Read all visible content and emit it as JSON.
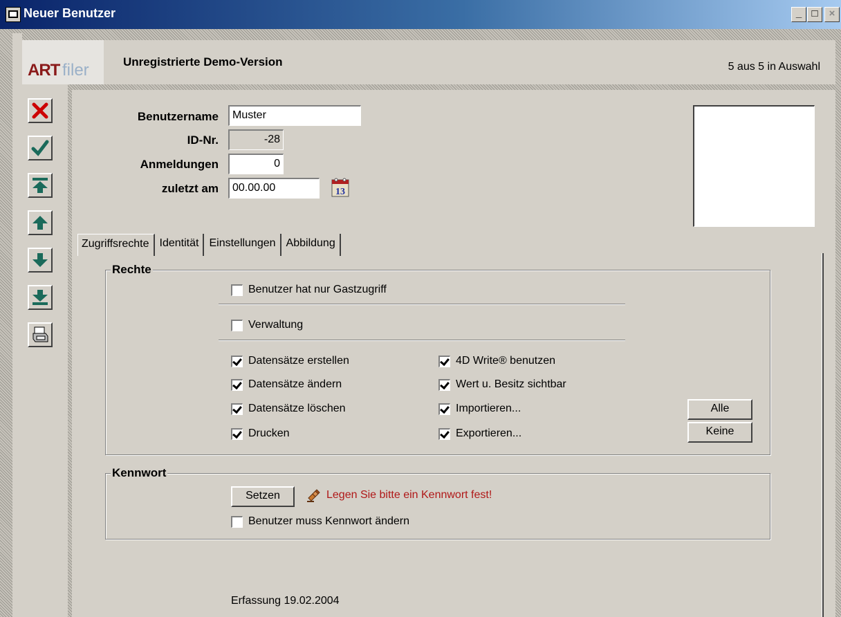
{
  "window": {
    "title": "Neuer Benutzer",
    "min_label": "_",
    "max_label": "□",
    "close_label": "×"
  },
  "header": {
    "logo_art": "ART",
    "logo_filer": "filer",
    "title": "Unregistrierte Demo-Version",
    "selection": "5 aus 5 in Auswahl"
  },
  "toolbar": {
    "items": [
      {
        "icon": "delete-x-icon"
      },
      {
        "icon": "check-icon"
      },
      {
        "icon": "first-record-icon"
      },
      {
        "icon": "previous-record-icon"
      },
      {
        "icon": "next-record-icon"
      },
      {
        "icon": "last-record-icon"
      },
      {
        "icon": "print-icon"
      }
    ]
  },
  "form": {
    "username_label": "Benutzername",
    "username_value": "Muster",
    "id_label": "ID-Nr.",
    "id_value": "-28",
    "logins_label": "Anmeldungen",
    "logins_value": "0",
    "last_label": "zuletzt am",
    "last_value": "00.00.00",
    "calendar_day": "13"
  },
  "tabs": [
    "Zugriffsrechte",
    "Identität",
    "Einstellungen",
    "Abbildung"
  ],
  "rights": {
    "title": "Rechte",
    "guest_only": {
      "label": "Benutzer hat nur Gastzugriff",
      "checked": false
    },
    "admin": {
      "label": "Verwaltung",
      "checked": false
    },
    "left": [
      {
        "label": "Datensätze erstellen",
        "checked": true
      },
      {
        "label": "Datensätze ändern",
        "checked": true
      },
      {
        "label": "Datensätze löschen",
        "checked": true
      },
      {
        "label": "Drucken",
        "checked": true
      }
    ],
    "right": [
      {
        "label": "4D Write® benutzen",
        "checked": true
      },
      {
        "label": "Wert u. Besitz sichtbar",
        "checked": true
      },
      {
        "label": "Importieren...",
        "checked": true
      },
      {
        "label": "Exportieren...",
        "checked": true
      }
    ],
    "all_button": "Alle",
    "none_button": "Keine"
  },
  "password": {
    "title": "Kennwort",
    "set_button": "Setzen",
    "warning": "Legen Sie bitte ein Kennwort fest!",
    "must_change": {
      "label": "Benutzer muss Kennwort ändern",
      "checked": false
    }
  },
  "footer": {
    "created": "Erfassung 19.02.2004"
  },
  "colors": {
    "warning": "#b01818",
    "title_bar": "#0a246a",
    "toolbar_icon": "#1a6a5a",
    "delete_icon": "#cc0000"
  }
}
